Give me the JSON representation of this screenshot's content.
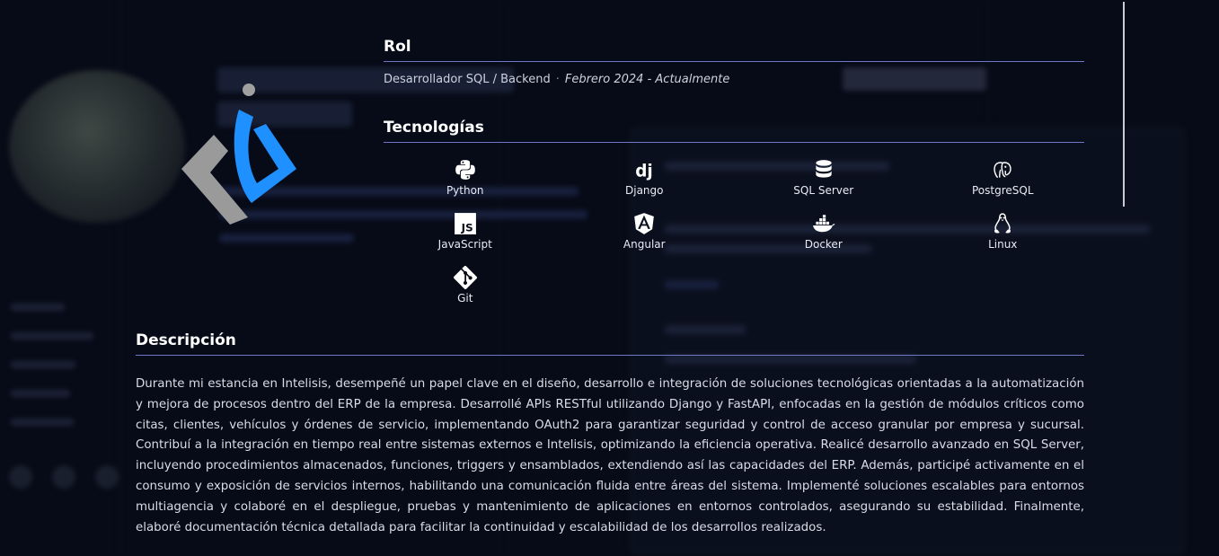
{
  "role": {
    "heading": "Rol",
    "title": "Desarrollador SQL / Backend",
    "separator": "·",
    "period": "Febrero 2024 - Actualmente"
  },
  "technologies": {
    "heading": "Tecnologías",
    "items": [
      {
        "label": "Python",
        "icon": "python-icon"
      },
      {
        "label": "Django",
        "icon": "django-icon"
      },
      {
        "label": "SQL Server",
        "icon": "database-icon"
      },
      {
        "label": "PostgreSQL",
        "icon": "postgresql-icon"
      },
      {
        "label": "JavaScript",
        "icon": "javascript-icon"
      },
      {
        "label": "Angular",
        "icon": "angular-icon"
      },
      {
        "label": "Docker",
        "icon": "docker-icon"
      },
      {
        "label": "Linux",
        "icon": "linux-icon"
      },
      {
        "label": "Git",
        "icon": "git-icon"
      }
    ]
  },
  "description": {
    "heading": "Descripción",
    "text": "Durante mi estancia en Intelisis, desempeñé un papel clave en el diseño, desarrollo e integración de soluciones tecnológicas orientadas a la automatización y mejora de procesos dentro del ERP de la empresa. Desarrollé APIs RESTful utilizando Django y FastAPI, enfocadas en la gestión de módulos críticos como citas, clientes, vehículos y órdenes de servicio, implementando OAuth2 para garantizar seguridad y control de acceso granular por empresa y sucursal. Contribuí a la integración en tiempo real entre sistemas externos e Intelisis, optimizando la eficiencia operativa. Realicé desarrollo avanzado en SQL Server, incluyendo procedimientos almacenados, funciones, triggers y ensamblados, extendiendo así las capacidades del ERP. Además, participé activamente en el consumo y exposición de servicios internos, habilitando una comunicación fluida entre áreas del sistema. Implementé soluciones escalables para entornos multiagencia y colaboré en el despliegue, pruebas y mantenimiento de aplicaciones en entornos controlados, asegurando su estabilidad. Finalmente, elaboré documentación técnica detallada para facilitar la continuidad y escalabilidad de los desarrollos realizados."
  },
  "colors": {
    "background": "#070b17",
    "divider": "#6f78c8",
    "logo_blue": "#1e90ff",
    "logo_gray": "#9a9a9a"
  }
}
